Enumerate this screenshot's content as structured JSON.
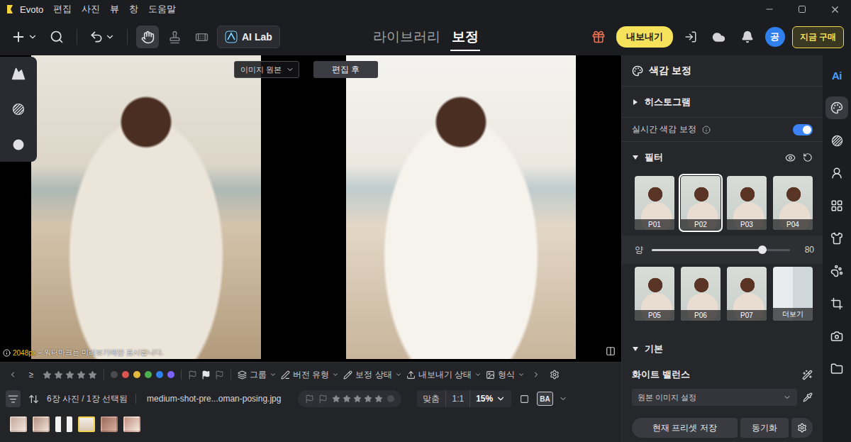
{
  "window": {
    "app_name": "Evoto",
    "menu": [
      "편집",
      "사진",
      "뷰",
      "창",
      "도움말"
    ]
  },
  "toolbar": {
    "tools": [
      {
        "kind": "hand",
        "selected": true
      },
      {
        "kind": "stamp",
        "selected": false
      },
      {
        "kind": "bandage",
        "selected": false
      }
    ],
    "ai_lab": "AI Lab",
    "nav_tabs": [
      {
        "label": "라이브러리",
        "selected": false
      },
      {
        "label": "보정",
        "selected": true
      }
    ],
    "export_button": "내보내기",
    "avatar": "공",
    "buy_button": "지금 구매"
  },
  "canvas": {
    "source_select": "이미지 원본",
    "after_label": "편집 후",
    "resolution": "2048px",
    "watermark_note": "– 워터마크는 미리보기에만 표시됩니다.",
    "left_tools": [
      {
        "kind": "portrait"
      },
      {
        "kind": "texture"
      },
      {
        "kind": "history"
      }
    ]
  },
  "filter_bar": {
    "operator": "≥",
    "stars": 0,
    "color_labels": [
      {
        "color": "#4a4b50"
      },
      {
        "color": "#d9534f"
      },
      {
        "color": "#e2b93b"
      },
      {
        "color": "#4caf50"
      },
      {
        "color": "#2f80ed"
      },
      {
        "color": "#7b61ff"
      }
    ],
    "flags": [
      {
        "kind": "plain"
      },
      {
        "kind": "picked"
      },
      {
        "kind": "rejected"
      }
    ],
    "menus": [
      {
        "label": "그룹",
        "kind": "group"
      },
      {
        "label": "버전 유형",
        "kind": "version"
      },
      {
        "label": "보정 상태",
        "kind": "edit"
      },
      {
        "label": "내보내기 상태",
        "kind": "export"
      },
      {
        "label": "형식",
        "kind": "format"
      }
    ]
  },
  "status_bar": {
    "count": "6장 사진 / 1장 선택됨",
    "file": "medium-shot-pre...oman-posing.jpg",
    "stars": 0,
    "zoom_fit": "맞춤",
    "zoom_actual": "1:1",
    "zoom": "15%",
    "compare": "BA"
  },
  "thumbnails": [
    {
      "selected": false
    },
    {
      "selected": false
    },
    {
      "selected": false
    },
    {
      "selected": true
    },
    {
      "selected": false
    },
    {
      "selected": false
    }
  ],
  "panel": {
    "title": "색감 보정",
    "histogram": {
      "label": "히스토그램",
      "expanded": false
    },
    "realtime": {
      "label": "실시간 색감 보정",
      "on": true
    },
    "filter": {
      "label": "필터",
      "expanded": true,
      "presets": [
        {
          "label": "P01",
          "selected": false,
          "kind": "preset"
        },
        {
          "label": "P02",
          "selected": true,
          "kind": "preset"
        },
        {
          "label": "P03",
          "selected": false,
          "kind": "preset"
        },
        {
          "label": "P04",
          "selected": false,
          "kind": "preset"
        },
        {
          "label": "P05",
          "selected": false,
          "kind": "preset"
        },
        {
          "label": "P06",
          "selected": false,
          "kind": "preset"
        },
        {
          "label": "P07",
          "selected": false,
          "kind": "preset"
        },
        {
          "label": "더보기",
          "selected": false,
          "kind": "more"
        }
      ],
      "amount": {
        "label": "양",
        "level": 0.8,
        "reading": "80"
      }
    },
    "basic": {
      "label": "기본",
      "expanded": true
    },
    "white_balance": {
      "label": "화이트 밸런스",
      "select": "원본 이미지 설정"
    },
    "buttons": [
      "현재 프리셋 저장",
      "동기화"
    ]
  },
  "side_icons": [
    {
      "kind": "ai",
      "label": "Ai",
      "selected": false
    },
    {
      "kind": "color",
      "selected": true
    },
    {
      "kind": "texture",
      "selected": false
    },
    {
      "kind": "face",
      "selected": false
    },
    {
      "kind": "grid",
      "selected": false
    },
    {
      "kind": "shirt",
      "selected": false
    },
    {
      "kind": "pet",
      "selected": false
    },
    {
      "kind": "crop",
      "selected": false
    },
    {
      "kind": "camera",
      "selected": false
    },
    {
      "kind": "folder",
      "selected": false
    }
  ]
}
